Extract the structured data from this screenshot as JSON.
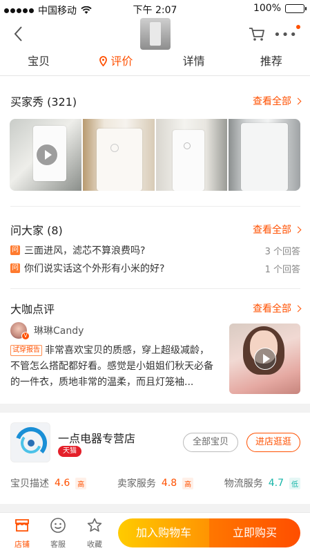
{
  "status_bar": {
    "carrier": "中国移动",
    "time": "下午 2:07",
    "battery": "100%"
  },
  "nav": {
    "back_icon": "chevron-left-icon",
    "cart_icon": "cart-icon",
    "more_icon": "more-icon"
  },
  "tabs": [
    {
      "label": "宝贝",
      "active": false
    },
    {
      "label": "评价",
      "active": true
    },
    {
      "label": "详情",
      "active": false
    },
    {
      "label": "推荐",
      "active": false
    }
  ],
  "buyer_show": {
    "title": "买家秀 (321)",
    "see_all": "查看全部"
  },
  "ask_all": {
    "title": "问大家 (8)",
    "see_all": "查看全部",
    "questions": [
      {
        "icon": "问",
        "text": "三面进风，滤芯不算浪费吗?",
        "count": "3 个回答"
      },
      {
        "icon": "问",
        "text": "你们说实话这个外形有小米的好?",
        "count": "1 个回答"
      }
    ]
  },
  "expert_review": {
    "title": "大咖点评",
    "see_all": "查看全部",
    "reviewer": "琳琳Candy",
    "badge": "V",
    "tag": "试穿报告",
    "text": "非常喜欢宝贝的质感，穿上超级减龄，不管怎么搭配都好看。感觉是小姐姐们秋天必备的一件衣，质地非常的温柔，而且灯笼袖..."
  },
  "store": {
    "name": "一点电器专营店",
    "badge": "天猫",
    "btn_all": "全部宝贝",
    "btn_visit": "进店逛逛",
    "scores": [
      {
        "label": "宝贝描述",
        "value": "4.6",
        "level": "高"
      },
      {
        "label": "卖家服务",
        "value": "4.8",
        "level": "高"
      },
      {
        "label": "物流服务",
        "value": "4.7",
        "level": "低"
      }
    ]
  },
  "bottom": {
    "shop": "店铺",
    "service": "客服",
    "favorite": "收藏",
    "add_cart": "加入购物车",
    "buy_now": "立即购买"
  },
  "colors": {
    "accent": "#ff5000",
    "tmall_red": "#e4202a",
    "low_score": "#16b5a8"
  }
}
